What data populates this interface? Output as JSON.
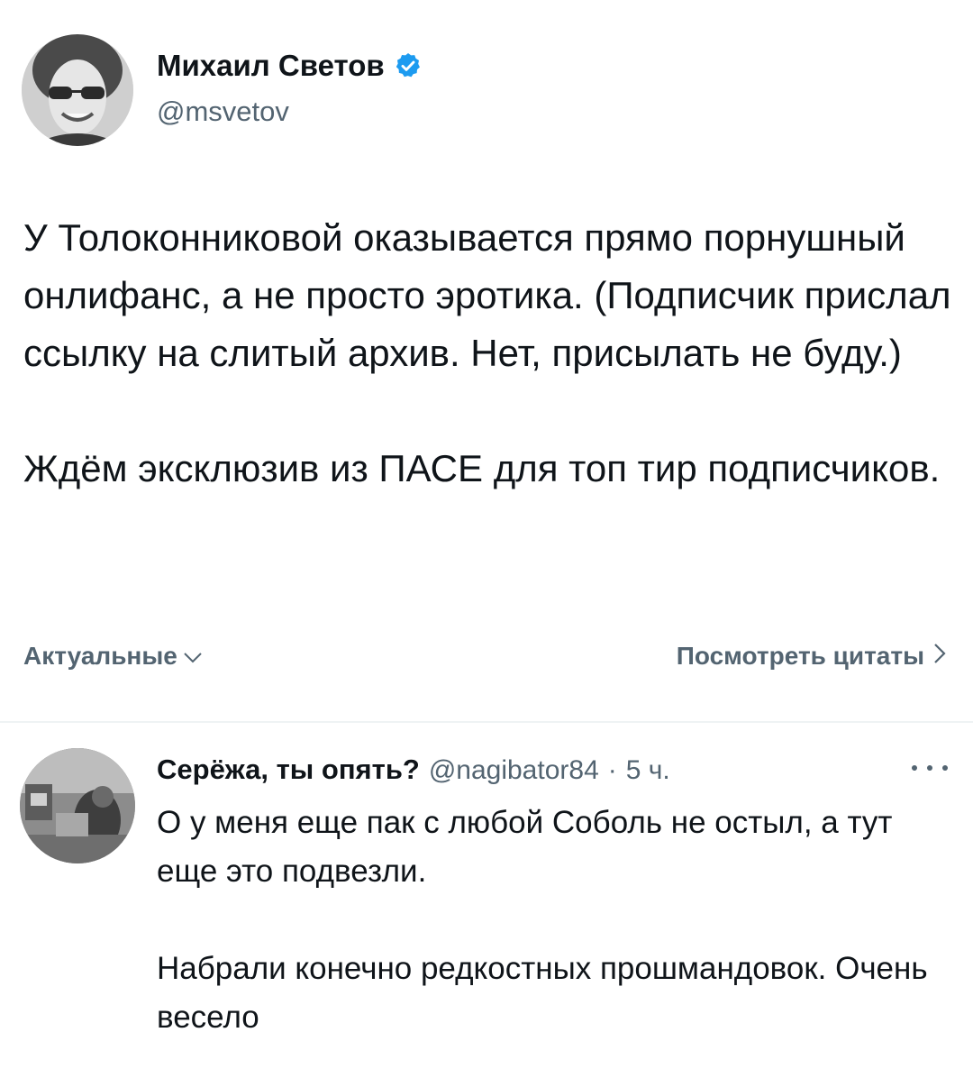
{
  "post": {
    "author": {
      "name": "Михаил Светов",
      "handle": "@msvetov",
      "verified": true
    },
    "paragraphs": [
      "У Толоконниковой оказывается прямо порнушный онлифанс, а не просто эротика. (Подписчик прислал ссылку на слитый архив. Нет, присылать не буду.)",
      "Ждём эксклюзив из ПАСЕ для топ тир подписчиков."
    ],
    "actions": {
      "relevant_label": "Актуальные",
      "view_quotes_label": "Посмотреть цитаты"
    }
  },
  "reply": {
    "author": {
      "name": "Серёжа, ты опять?",
      "handle": "@nagibator84",
      "time": "5 ч."
    },
    "separator": "·",
    "paragraphs": [
      "О у меня еще пак с любой Соболь не остыл, а тут еще это подвезли.",
      "Набрали конечно редкостных прошмандовок. Очень весело"
    ]
  },
  "colors": {
    "text_primary": "#0f1419",
    "text_secondary": "#536471",
    "verified_badge": "#1d9bf0",
    "divider": "#eff3f4"
  },
  "icons": {
    "verified": "verified-badge-icon",
    "relevant_chevron": "chevron-down-icon",
    "quotes_chevron": "chevron-right-icon",
    "reply_more": "more-horizontal-icon"
  }
}
